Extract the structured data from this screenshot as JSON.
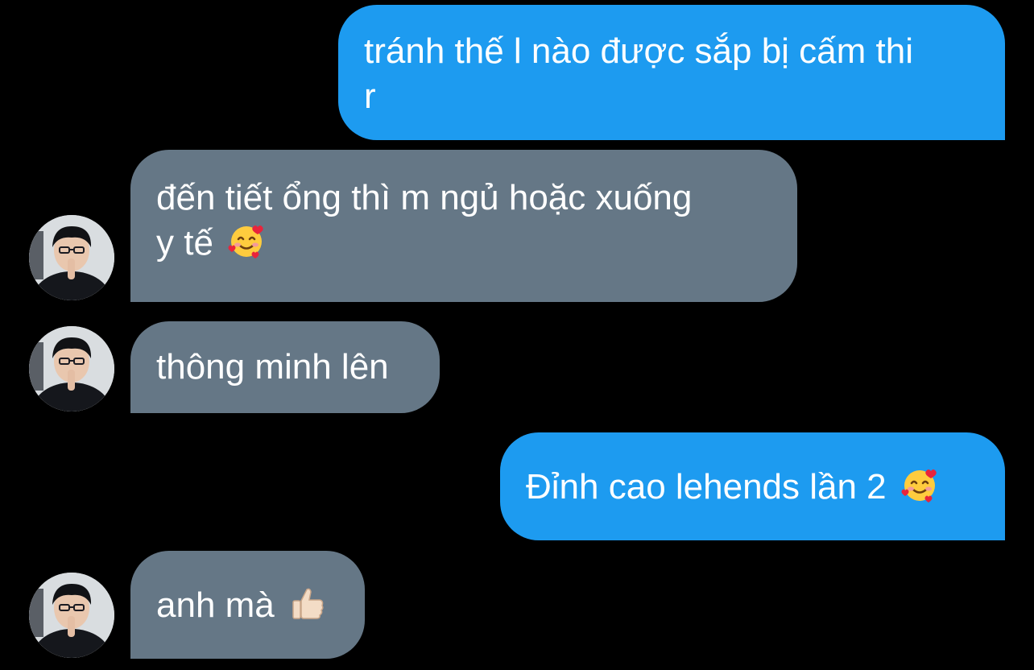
{
  "messages": [
    {
      "direction": "outgoing",
      "text_line1": "tránh thế l nào được sắp bị cấm thi",
      "text_line2": "r"
    },
    {
      "direction": "incoming",
      "text_line1": "đến tiết ổng thì m ngủ hoặc xuống",
      "text_line2": "y tế",
      "emoji": "smiling-face-with-hearts"
    },
    {
      "direction": "incoming",
      "text": "thông minh lên"
    },
    {
      "direction": "outgoing",
      "text": "Đỉnh cao lehends lần 2",
      "emoji": "smiling-face-with-hearts"
    },
    {
      "direction": "incoming",
      "text": "anh mà",
      "emoji": "thumbs-up-light-skin"
    }
  ],
  "colors": {
    "background": "#000000",
    "outgoing_bubble": "#1d9bf0",
    "incoming_bubble": "#657786",
    "text": "#ffffff"
  }
}
